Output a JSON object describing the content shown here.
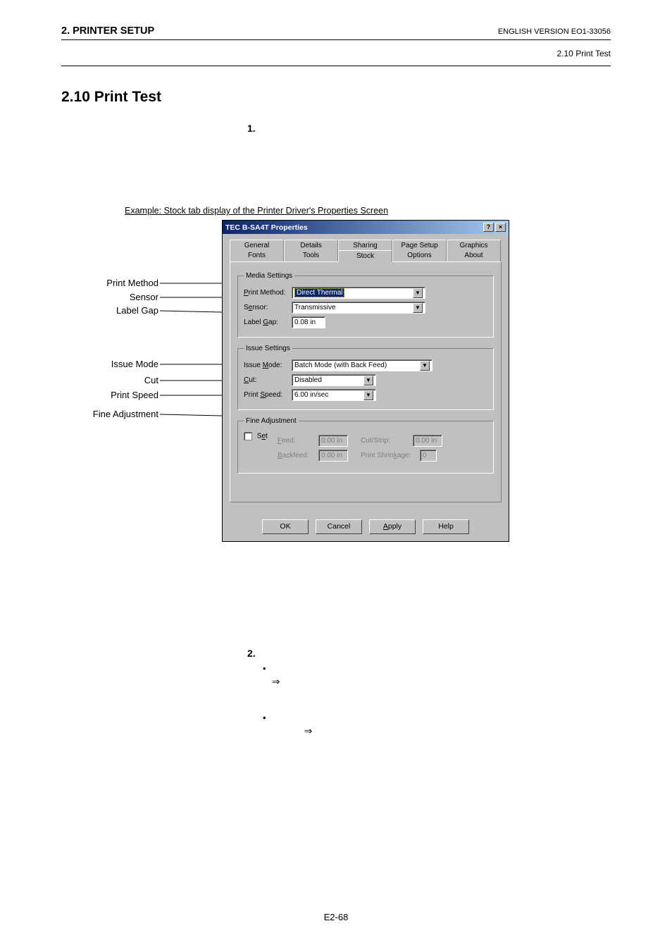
{
  "header": {
    "left": "2. PRINTER SETUP",
    "right": "ENGLISH VERSION EO1-33056",
    "sub": "2.10 Print Test"
  },
  "section_title": "2.10  Print Test",
  "steps": {
    "one": "1.",
    "two": "2."
  },
  "example_caption": "Example: Stock tab display of the Printer Driver's Properties Screen",
  "callouts": {
    "print_method": "Print Method",
    "sensor": "Sensor",
    "label_gap": "Label Gap",
    "issue_mode": "Issue Mode",
    "cut": "Cut",
    "print_speed": "Print Speed",
    "fine_adjustment": "Fine Adjustment"
  },
  "dialog": {
    "title": "TEC B-SA4T Properties",
    "titlebar_btns": {
      "help": "?",
      "close": "×"
    },
    "tabs_back": [
      "General",
      "Details",
      "Sharing",
      "Page Setup",
      "Graphics"
    ],
    "tabs_front": [
      "Fonts",
      "Tools",
      "Stock",
      "Options",
      "About"
    ],
    "groups": {
      "media": {
        "legend": "Media Settings",
        "print_method_label": "Print Method:",
        "print_method_value": "Direct Thermal",
        "sensor_label": "Sensor:",
        "sensor_value": "Transmissive",
        "label_gap_label": "Label Gap:",
        "label_gap_value": "0.08 in"
      },
      "issue": {
        "legend": "Issue Settings",
        "issue_mode_label": "Issue Mode:",
        "issue_mode_value": "Batch Mode (with Back Feed)",
        "cut_label": "Cut:",
        "cut_value": "Disabled",
        "print_speed_label": "Print Speed:",
        "print_speed_value": "6.00 in/sec"
      },
      "fine": {
        "legend": "Fine Adjustment",
        "set_label": "Set",
        "feed_label": "Feed:",
        "feed_value": "0.00 in",
        "cutstrip_label": "Cut/Strip:",
        "cutstrip_value": "0.00 in",
        "backfeed_label": "Backfeed:",
        "backfeed_value": "0.00 in",
        "shrink_label": "Print Shrinkage:",
        "shrink_value": "0"
      }
    },
    "buttons": {
      "ok": "OK",
      "cancel": "Cancel",
      "apply": "Apply",
      "help": "Help"
    }
  },
  "arrow": "⇒",
  "bullet": "•",
  "footer": "E2-68"
}
